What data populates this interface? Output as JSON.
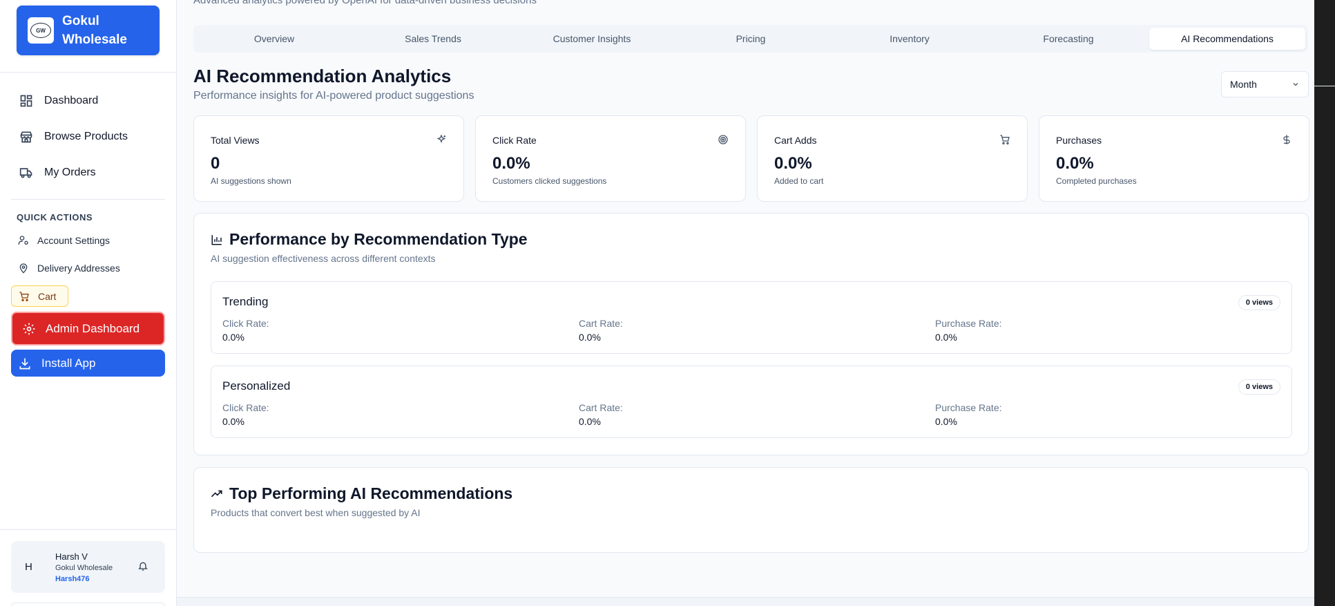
{
  "app": {
    "brand_line1": "Gokul",
    "brand_line2": "Wholesale",
    "logo_text": "GW"
  },
  "sidebar": {
    "nav": [
      {
        "label": "Dashboard",
        "icon": "dashboard-grid-icon"
      },
      {
        "label": "Browse Products",
        "icon": "store-icon"
      },
      {
        "label": "My Orders",
        "icon": "truck-icon"
      }
    ],
    "quick_actions_title": "QUICK ACTIONS",
    "quick_actions": [
      {
        "label": "Account Settings",
        "icon": "user-settings-icon"
      },
      {
        "label": "Delivery Addresses",
        "icon": "map-pin-icon"
      }
    ],
    "cart_label": "Cart",
    "admin_label": "Admin Dashboard",
    "install_label": "Install App",
    "user": {
      "initial": "H",
      "name": "Harsh V",
      "company": "Gokul Wholesale",
      "handle": "Harsh476"
    }
  },
  "header": {
    "subtitle": "Advanced analytics powered by OpenAI for data-driven business decisions"
  },
  "tabs": [
    {
      "label": "Overview",
      "active": false
    },
    {
      "label": "Sales Trends",
      "active": false
    },
    {
      "label": "Customer Insights",
      "active": false
    },
    {
      "label": "Pricing",
      "active": false
    },
    {
      "label": "Inventory",
      "active": false
    },
    {
      "label": "Forecasting",
      "active": false
    },
    {
      "label": "AI Recommendations",
      "active": true
    }
  ],
  "main": {
    "title": "AI Recommendation Analytics",
    "subtitle": "Performance insights for AI-powered product suggestions",
    "period_select": "Month",
    "stats": [
      {
        "label": "Total Views",
        "value": "0",
        "sub": "AI suggestions shown",
        "icon": "sparkles-icon"
      },
      {
        "label": "Click Rate",
        "value": "0.0%",
        "sub": "Customers clicked suggestions",
        "icon": "target-icon"
      },
      {
        "label": "Cart Adds",
        "value": "0.0%",
        "sub": "Added to cart",
        "icon": "cart-icon"
      },
      {
        "label": "Purchases",
        "value": "0.0%",
        "sub": "Completed purchases",
        "icon": "dollar-icon"
      }
    ],
    "performance": {
      "title": "Performance by Recommendation Type",
      "subtitle": "AI suggestion effectiveness across different contexts",
      "rows": [
        {
          "name": "Trending",
          "views": "0 views",
          "click_label": "Click Rate:",
          "click": "0.0%",
          "cart_label": "Cart Rate:",
          "cart": "0.0%",
          "purchase_label": "Purchase Rate:",
          "purchase": "0.0%"
        },
        {
          "name": "Personalized",
          "views": "0 views",
          "click_label": "Click Rate:",
          "click": "0.0%",
          "cart_label": "Cart Rate:",
          "cart": "0.0%",
          "purchase_label": "Purchase Rate:",
          "purchase": "0.0%"
        }
      ]
    },
    "top": {
      "title": "Top Performing AI Recommendations",
      "subtitle": "Products that convert best when suggested by AI"
    }
  },
  "colors": {
    "primary": "#2563eb",
    "danger": "#dc2626",
    "cart_bg": "#fffbeb"
  }
}
